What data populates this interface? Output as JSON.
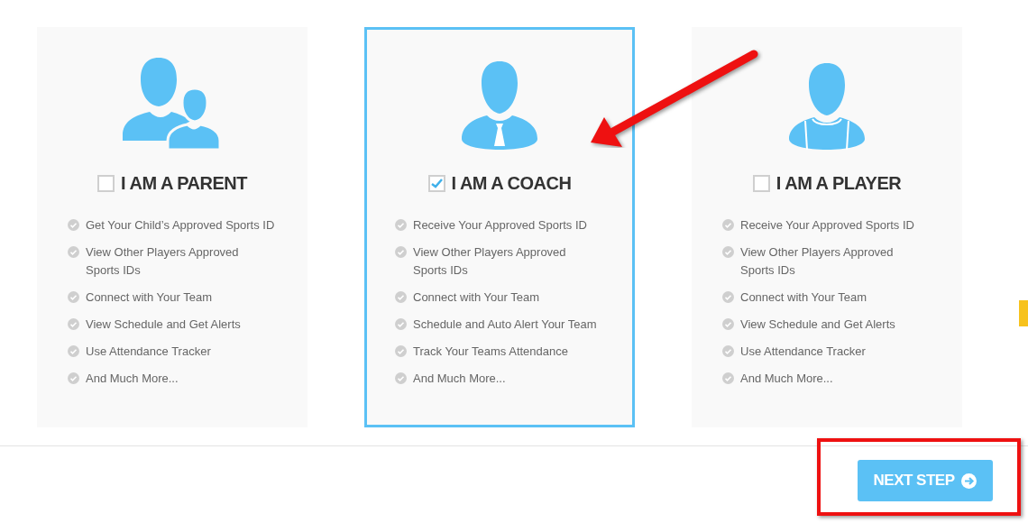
{
  "roles": [
    {
      "kind": "parent",
      "title": "I AM A PARENT",
      "selected": false,
      "checked": false,
      "features": [
        "Get Your Child’s Approved Sports ID",
        "View Other Players Approved Sports IDs",
        "Connect with Your Team",
        "View Schedule and Get Alerts",
        "Use Attendance Tracker",
        "And Much More..."
      ]
    },
    {
      "kind": "coach",
      "title": "I AM A COACH",
      "selected": true,
      "checked": true,
      "features": [
        "Receive Your Approved Sports ID",
        "View Other Players Approved Sports IDs",
        "Connect with Your Team",
        "Schedule and Auto Alert Your Team",
        "Track Your Teams Attendance",
        "And Much More..."
      ]
    },
    {
      "kind": "player",
      "title": "I AM A PLAYER",
      "selected": false,
      "checked": false,
      "features": [
        "Receive Your Approved Sports ID",
        "View Other Players Approved Sports IDs",
        "Connect with Your Team",
        "View Schedule and Get Alerts",
        "Use Attendance Tracker",
        "And Much More..."
      ]
    }
  ],
  "next_button": {
    "label": "NEXT STEP"
  }
}
